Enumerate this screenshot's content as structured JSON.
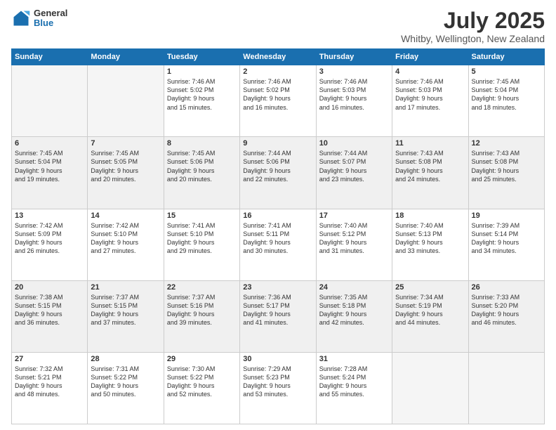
{
  "logo": {
    "general": "General",
    "blue": "Blue"
  },
  "title": "July 2025",
  "subtitle": "Whitby, Wellington, New Zealand",
  "days": [
    "Sunday",
    "Monday",
    "Tuesday",
    "Wednesday",
    "Thursday",
    "Friday",
    "Saturday"
  ],
  "weeks": [
    [
      {
        "num": "",
        "lines": []
      },
      {
        "num": "",
        "lines": []
      },
      {
        "num": "1",
        "lines": [
          "Sunrise: 7:46 AM",
          "Sunset: 5:02 PM",
          "Daylight: 9 hours",
          "and 15 minutes."
        ]
      },
      {
        "num": "2",
        "lines": [
          "Sunrise: 7:46 AM",
          "Sunset: 5:02 PM",
          "Daylight: 9 hours",
          "and 16 minutes."
        ]
      },
      {
        "num": "3",
        "lines": [
          "Sunrise: 7:46 AM",
          "Sunset: 5:03 PM",
          "Daylight: 9 hours",
          "and 16 minutes."
        ]
      },
      {
        "num": "4",
        "lines": [
          "Sunrise: 7:46 AM",
          "Sunset: 5:03 PM",
          "Daylight: 9 hours",
          "and 17 minutes."
        ]
      },
      {
        "num": "5",
        "lines": [
          "Sunrise: 7:45 AM",
          "Sunset: 5:04 PM",
          "Daylight: 9 hours",
          "and 18 minutes."
        ]
      }
    ],
    [
      {
        "num": "6",
        "lines": [
          "Sunrise: 7:45 AM",
          "Sunset: 5:04 PM",
          "Daylight: 9 hours",
          "and 19 minutes."
        ]
      },
      {
        "num": "7",
        "lines": [
          "Sunrise: 7:45 AM",
          "Sunset: 5:05 PM",
          "Daylight: 9 hours",
          "and 20 minutes."
        ]
      },
      {
        "num": "8",
        "lines": [
          "Sunrise: 7:45 AM",
          "Sunset: 5:06 PM",
          "Daylight: 9 hours",
          "and 20 minutes."
        ]
      },
      {
        "num": "9",
        "lines": [
          "Sunrise: 7:44 AM",
          "Sunset: 5:06 PM",
          "Daylight: 9 hours",
          "and 22 minutes."
        ]
      },
      {
        "num": "10",
        "lines": [
          "Sunrise: 7:44 AM",
          "Sunset: 5:07 PM",
          "Daylight: 9 hours",
          "and 23 minutes."
        ]
      },
      {
        "num": "11",
        "lines": [
          "Sunrise: 7:43 AM",
          "Sunset: 5:08 PM",
          "Daylight: 9 hours",
          "and 24 minutes."
        ]
      },
      {
        "num": "12",
        "lines": [
          "Sunrise: 7:43 AM",
          "Sunset: 5:08 PM",
          "Daylight: 9 hours",
          "and 25 minutes."
        ]
      }
    ],
    [
      {
        "num": "13",
        "lines": [
          "Sunrise: 7:42 AM",
          "Sunset: 5:09 PM",
          "Daylight: 9 hours",
          "and 26 minutes."
        ]
      },
      {
        "num": "14",
        "lines": [
          "Sunrise: 7:42 AM",
          "Sunset: 5:10 PM",
          "Daylight: 9 hours",
          "and 27 minutes."
        ]
      },
      {
        "num": "15",
        "lines": [
          "Sunrise: 7:41 AM",
          "Sunset: 5:10 PM",
          "Daylight: 9 hours",
          "and 29 minutes."
        ]
      },
      {
        "num": "16",
        "lines": [
          "Sunrise: 7:41 AM",
          "Sunset: 5:11 PM",
          "Daylight: 9 hours",
          "and 30 minutes."
        ]
      },
      {
        "num": "17",
        "lines": [
          "Sunrise: 7:40 AM",
          "Sunset: 5:12 PM",
          "Daylight: 9 hours",
          "and 31 minutes."
        ]
      },
      {
        "num": "18",
        "lines": [
          "Sunrise: 7:40 AM",
          "Sunset: 5:13 PM",
          "Daylight: 9 hours",
          "and 33 minutes."
        ]
      },
      {
        "num": "19",
        "lines": [
          "Sunrise: 7:39 AM",
          "Sunset: 5:14 PM",
          "Daylight: 9 hours",
          "and 34 minutes."
        ]
      }
    ],
    [
      {
        "num": "20",
        "lines": [
          "Sunrise: 7:38 AM",
          "Sunset: 5:15 PM",
          "Daylight: 9 hours",
          "and 36 minutes."
        ]
      },
      {
        "num": "21",
        "lines": [
          "Sunrise: 7:37 AM",
          "Sunset: 5:15 PM",
          "Daylight: 9 hours",
          "and 37 minutes."
        ]
      },
      {
        "num": "22",
        "lines": [
          "Sunrise: 7:37 AM",
          "Sunset: 5:16 PM",
          "Daylight: 9 hours",
          "and 39 minutes."
        ]
      },
      {
        "num": "23",
        "lines": [
          "Sunrise: 7:36 AM",
          "Sunset: 5:17 PM",
          "Daylight: 9 hours",
          "and 41 minutes."
        ]
      },
      {
        "num": "24",
        "lines": [
          "Sunrise: 7:35 AM",
          "Sunset: 5:18 PM",
          "Daylight: 9 hours",
          "and 42 minutes."
        ]
      },
      {
        "num": "25",
        "lines": [
          "Sunrise: 7:34 AM",
          "Sunset: 5:19 PM",
          "Daylight: 9 hours",
          "and 44 minutes."
        ]
      },
      {
        "num": "26",
        "lines": [
          "Sunrise: 7:33 AM",
          "Sunset: 5:20 PM",
          "Daylight: 9 hours",
          "and 46 minutes."
        ]
      }
    ],
    [
      {
        "num": "27",
        "lines": [
          "Sunrise: 7:32 AM",
          "Sunset: 5:21 PM",
          "Daylight: 9 hours",
          "and 48 minutes."
        ]
      },
      {
        "num": "28",
        "lines": [
          "Sunrise: 7:31 AM",
          "Sunset: 5:22 PM",
          "Daylight: 9 hours",
          "and 50 minutes."
        ]
      },
      {
        "num": "29",
        "lines": [
          "Sunrise: 7:30 AM",
          "Sunset: 5:22 PM",
          "Daylight: 9 hours",
          "and 52 minutes."
        ]
      },
      {
        "num": "30",
        "lines": [
          "Sunrise: 7:29 AM",
          "Sunset: 5:23 PM",
          "Daylight: 9 hours",
          "and 53 minutes."
        ]
      },
      {
        "num": "31",
        "lines": [
          "Sunrise: 7:28 AM",
          "Sunset: 5:24 PM",
          "Daylight: 9 hours",
          "and 55 minutes."
        ]
      },
      {
        "num": "",
        "lines": []
      },
      {
        "num": "",
        "lines": []
      }
    ]
  ]
}
